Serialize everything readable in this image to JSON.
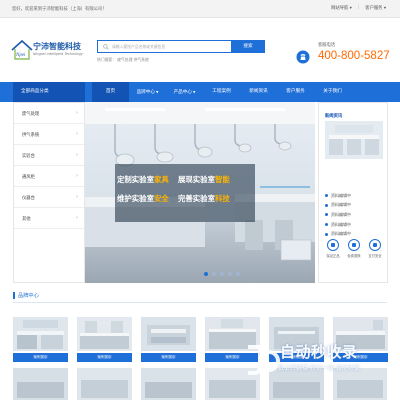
{
  "topbar": {
    "welcome": "您好，欢迎来到宁沛智能科技（上海）有限公司！",
    "links": [
      "网站导航",
      "客户服务"
    ]
  },
  "logo": {
    "cn": "宁沛智能科技",
    "en": "Ningpei Intelligent Technology",
    "mark_text": "Npei"
  },
  "search": {
    "placeholder": "请输入要找产品名称或关键信息",
    "button": "搜索",
    "hot": "热门搜索： 废气处理  供气系统"
  },
  "contact": {
    "label": "客服电话",
    "phone": "400-800-5827"
  },
  "nav": {
    "category": "全部商品分类",
    "items": [
      {
        "label": "首页",
        "dropdown": false
      },
      {
        "label": "品牌中心",
        "dropdown": true
      },
      {
        "label": "产品中心",
        "dropdown": true
      },
      {
        "label": "工程案例",
        "dropdown": false
      },
      {
        "label": "新闻资讯",
        "dropdown": false
      },
      {
        "label": "客户服务",
        "dropdown": false
      },
      {
        "label": "关于我们",
        "dropdown": false
      }
    ]
  },
  "sidebar": {
    "items": [
      {
        "label": "废气处理"
      },
      {
        "label": "供气系统"
      },
      {
        "label": "实验台"
      },
      {
        "label": "通风柜"
      },
      {
        "label": "仪器台"
      },
      {
        "label": "其他"
      }
    ]
  },
  "banner": {
    "line1": {
      "a": "定制实验室",
      "b": "家具"
    },
    "line2": {
      "a": "展现实验室",
      "b": "智能"
    },
    "line3": {
      "a": "维护实验室",
      "b": "安全"
    },
    "line4": {
      "a": "完善实验室",
      "b": "科技"
    },
    "slides": 5,
    "active_slide": 1
  },
  "news": {
    "title": "新闻资讯",
    "items": [
      "资料编辑中",
      "资料编辑中",
      "资料编辑中",
      "资料编辑中",
      "资料编辑中"
    ],
    "services": [
      "保证正品",
      "免费退换",
      "支付安全"
    ]
  },
  "section": {
    "title": "品牌中心"
  },
  "products": [
    {
      "label": "案例赏析"
    },
    {
      "label": "案例赏析"
    },
    {
      "label": "案例赏析"
    },
    {
      "label": "案例赏析"
    },
    {
      "label": "案例赏析"
    },
    {
      "label": "案例赏析"
    }
  ],
  "watermark": {
    "big": "自动秒收录",
    "small": "数上传链接·秒访一次·自动收录"
  },
  "colors": {
    "primary": "#1f6fd8",
    "primary_dark": "#1253b4",
    "phone": "#ff6a00",
    "highlight": "#ffb400"
  }
}
